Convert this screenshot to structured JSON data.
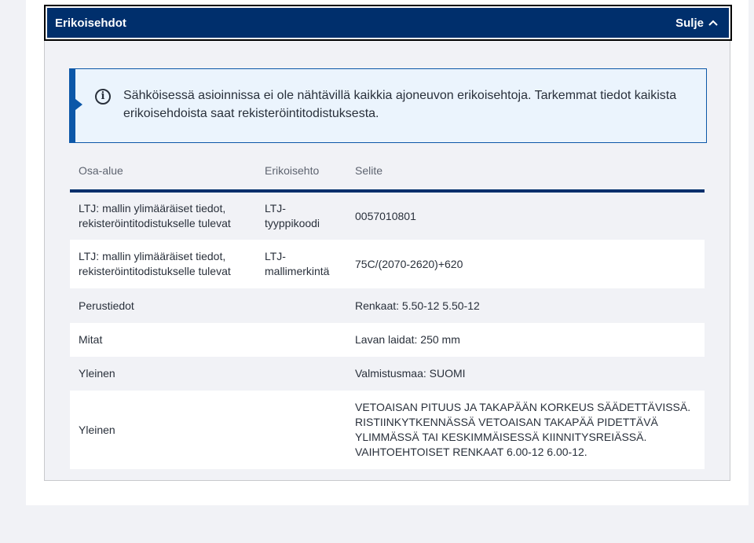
{
  "accordion": {
    "title": "Erikoisehdot",
    "close_label": "Sulje"
  },
  "notice": {
    "icon": "info-icon",
    "text": "Sähköisessä asioinnissa ei ole nähtävillä kaikkia ajoneuvon erikoisehtoja. Tarkemmat tiedot kaikista erikoisehdoista saat rekisteröintitodistuksesta."
  },
  "table": {
    "headers": [
      "Osa-alue",
      "Erikoisehto",
      "Selite"
    ],
    "rows": [
      [
        "LTJ: mallin ylimääräiset tiedot, rekisteröintitodistukselle tulevat",
        "LTJ-tyyppikoodi",
        "0057010801"
      ],
      [
        "LTJ: mallin ylimääräiset tiedot, rekisteröintitodistukselle tulevat",
        "LTJ-mallimerkintä",
        "75C/(2070-2620)+620"
      ],
      [
        "Perustiedot",
        "",
        "Renkaat: 5.50-12 5.50-12"
      ],
      [
        "Mitat",
        "",
        "Lavan laidat: 250 mm"
      ],
      [
        "Yleinen",
        "",
        "Valmistusmaa: SUOMI"
      ],
      [
        "Yleinen",
        "",
        "VETOAISAN PITUUS JA TAKAPÄÄN KORKEUS SÄÄDETTÄVISSÄ. RISTIINKYTKENNÄSSÄ VETOAISAN TAKAPÄÄ PIDETTÄVÄ YLIMMÄSSÄ TAI KESKIMMÄISESSÄ KIINNITYSREIÄSSÄ. VAIHTOEHTOISET RENKAAT 6.00-12 6.00-12."
      ]
    ]
  }
}
